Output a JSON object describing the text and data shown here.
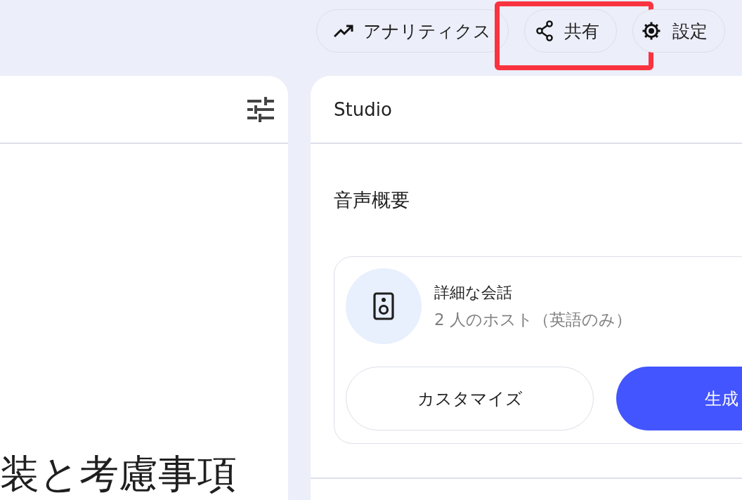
{
  "toolbar": [
    {
      "kind": "analytics",
      "label": "アナリティクス",
      "highlighted": false
    },
    {
      "kind": "share",
      "label": "共有",
      "highlighted": true
    },
    {
      "kind": "settings",
      "label": "設定",
      "highlighted": false
    }
  ],
  "sources_panel": {
    "heading": "装と考慮事項"
  },
  "studio_panel": {
    "title": "Studio",
    "section": "音声概要",
    "card": {
      "title": "詳細な会話",
      "subtitle": "2 人のホスト（英語のみ）",
      "buttons": [
        {
          "kind": "secondary",
          "label": "カスタマイズ"
        },
        {
          "kind": "primary",
          "label": "生成"
        }
      ]
    }
  }
}
